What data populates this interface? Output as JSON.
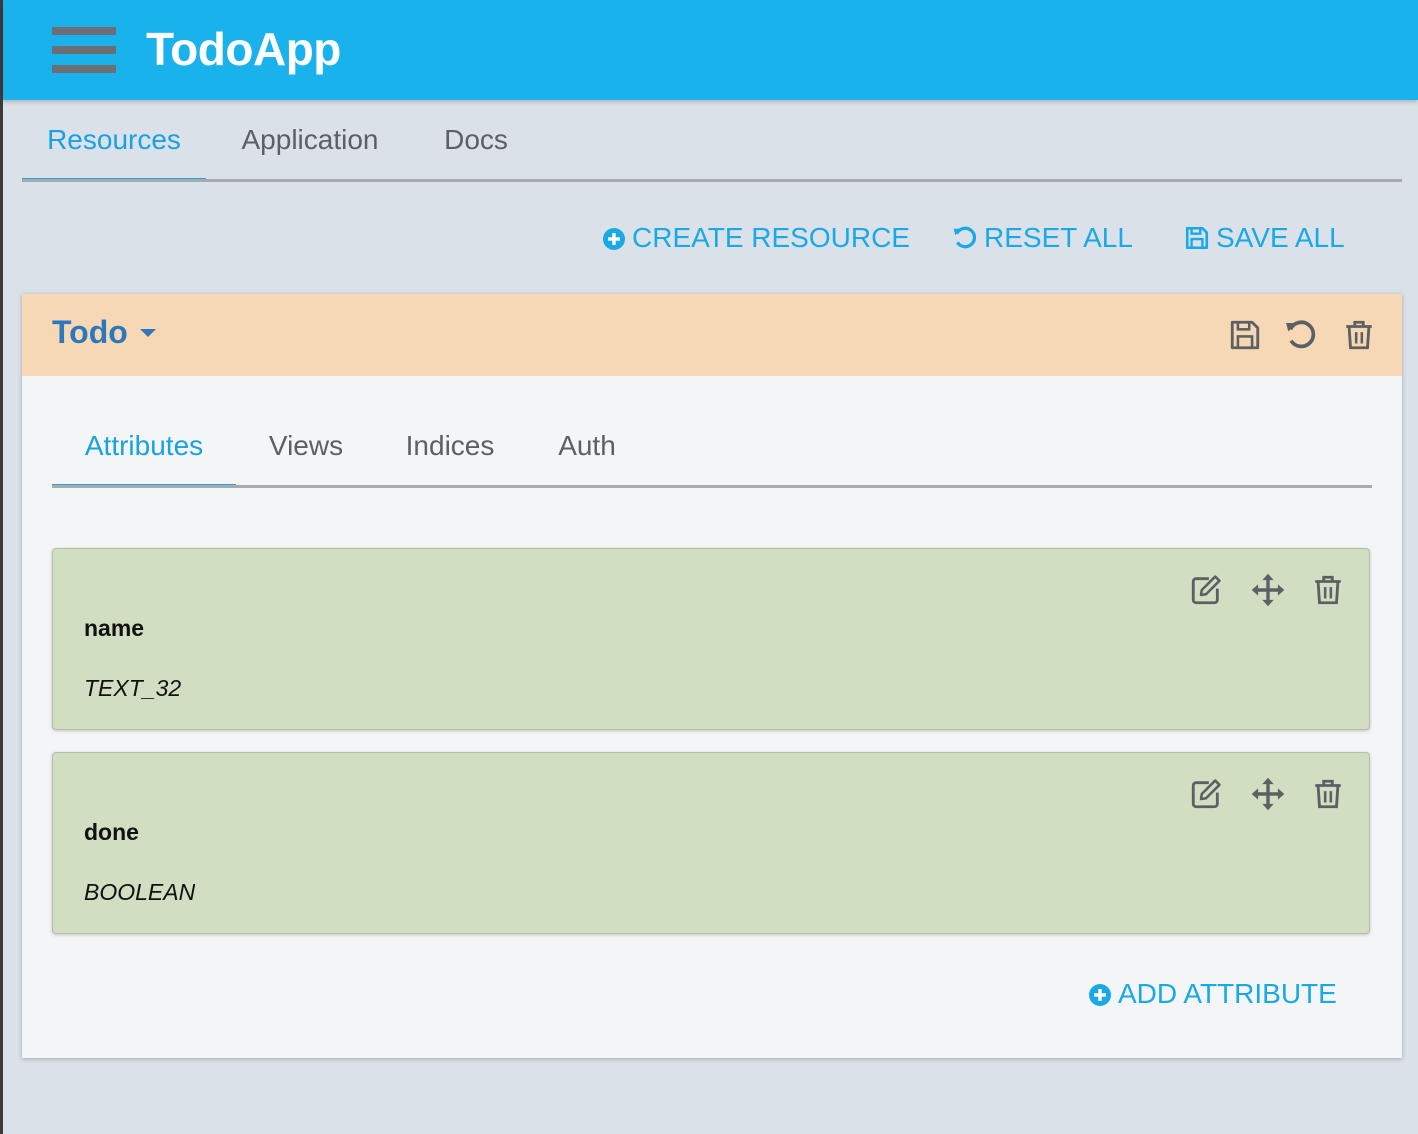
{
  "app": {
    "title": "TodoApp"
  },
  "main_tabs": [
    {
      "label": "Resources",
      "active": true
    },
    {
      "label": "Application",
      "active": false
    },
    {
      "label": "Docs",
      "active": false
    }
  ],
  "actions": {
    "create_resource": "CREATE RESOURCE",
    "reset_all": "RESET ALL",
    "save_all": "SAVE ALL"
  },
  "resource": {
    "name": "Todo",
    "header_icons": [
      "save-icon",
      "undo-icon",
      "trash-icon"
    ],
    "tabs": [
      {
        "label": "Attributes",
        "active": true
      },
      {
        "label": "Views",
        "active": false
      },
      {
        "label": "Indices",
        "active": false
      },
      {
        "label": "Auth",
        "active": false
      }
    ],
    "attributes": [
      {
        "name": "name",
        "type": "TEXT_32"
      },
      {
        "name": "done",
        "type": "BOOLEAN"
      }
    ],
    "attribute_icons": [
      "edit-icon",
      "move-icon",
      "trash-icon"
    ],
    "add_attribute": "ADD ATTRIBUTE"
  },
  "colors": {
    "appbar": "#19b2ec",
    "accent": "#19a9e6",
    "resource_header": "#f6d8b5",
    "attribute_card": "#d1dec2",
    "resource_title": "#2c77bd"
  }
}
